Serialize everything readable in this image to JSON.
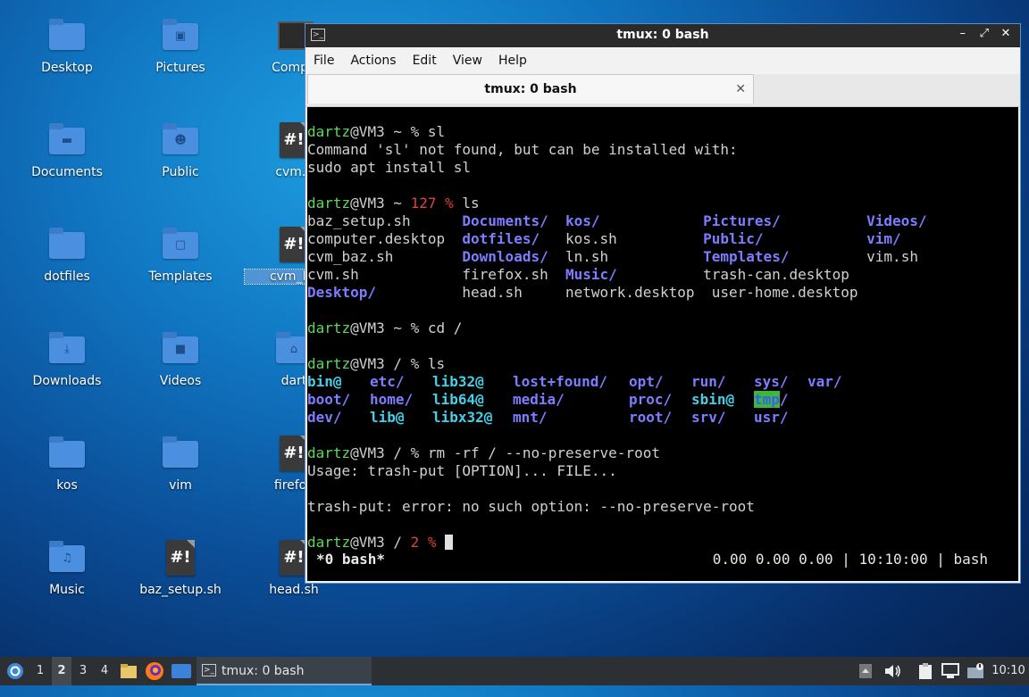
{
  "desktop": {
    "icons": [
      {
        "label": "Desktop",
        "type": "folder",
        "emblem": ""
      },
      {
        "label": "Pictures",
        "type": "folder",
        "emblem": "▣"
      },
      {
        "label": "Compu",
        "type": "monitor",
        "emblem": ""
      },
      {
        "label": "Documents",
        "type": "folder",
        "emblem": "▬"
      },
      {
        "label": "Public",
        "type": "folder",
        "emblem": "☻"
      },
      {
        "label": "cvm.s",
        "type": "script",
        "emblem": "#!"
      },
      {
        "label": "dotfiles",
        "type": "folder",
        "emblem": ""
      },
      {
        "label": "Templates",
        "type": "folder",
        "emblem": "▢"
      },
      {
        "label": "cvm_ba",
        "type": "script",
        "emblem": "#!"
      },
      {
        "label": "Downloads",
        "type": "folder",
        "emblem": "⤓"
      },
      {
        "label": "Videos",
        "type": "folder",
        "emblem": "■"
      },
      {
        "label": "dart",
        "type": "folder",
        "emblem": "⌂"
      },
      {
        "label": "kos",
        "type": "folder",
        "emblem": ""
      },
      {
        "label": "vim",
        "type": "folder",
        "emblem": ""
      },
      {
        "label": "firefox",
        "type": "script",
        "emblem": "#!"
      },
      {
        "label": "Music",
        "type": "folder",
        "emblem": "♫"
      },
      {
        "label": "baz_setup.sh",
        "type": "script",
        "emblem": "#!"
      },
      {
        "label": "head.sh",
        "type": "script",
        "emblem": "#!"
      }
    ]
  },
  "window": {
    "title": "tmux: 0 bash",
    "controls": {
      "minimize": "–",
      "maximize": "⤢",
      "close": "✕"
    },
    "menu": [
      "File",
      "Actions",
      "Edit",
      "View",
      "Help"
    ],
    "tab": {
      "label": "tmux: 0 bash",
      "close": "✕"
    }
  },
  "terminal": {
    "user": "dartz",
    "host": "@VM3",
    "l1": {
      "dir": " ~ ",
      "code": "",
      "sym": "% ",
      "cmd": "sl"
    },
    "out1": "Command 'sl' not found, but can be installed with:",
    "out2": "sudo apt install sl",
    "l2": {
      "dir": " ~ ",
      "code": "127 ",
      "sym": "% ",
      "cmd": "ls"
    },
    "home_ls": [
      [
        "baz_setup.sh      ",
        "Documents/",
        "  ",
        "kos/",
        "            ",
        "Pictures/",
        "          ",
        "Videos/"
      ],
      [
        "computer.desktop  ",
        "dotfiles/",
        "   ",
        "kos.sh",
        "          ",
        "Public/",
        "            ",
        "vim/"
      ],
      [
        "cvm_baz.sh        ",
        "Downloads/",
        "  ",
        "ln.sh",
        "           ",
        "Templates/",
        "         ",
        "vim.sh"
      ],
      [
        "cvm.sh            ",
        "firefox.sh",
        "  ",
        "Music/",
        "          ",
        "trash-can.desktop",
        "",
        ""
      ],
      [
        "Desktop/",
        "          ",
        "head.sh",
        "     ",
        "network.desktop",
        "  user-home.desktop",
        "",
        ""
      ]
    ],
    "l3": {
      "dir": " ~ ",
      "code": "",
      "sym": "% ",
      "cmd": "cd /"
    },
    "l4": {
      "dir": " / ",
      "code": "",
      "sym": "% ",
      "cmd": "ls"
    },
    "root_ls": [
      [
        "bin@",
        "etc/",
        "lib32@",
        "lost+found/",
        "opt/",
        "run/",
        "sys/",
        "var/"
      ],
      [
        "boot/",
        "home/",
        "lib64@",
        "media/",
        "proc/",
        "sbin@",
        "tmp",
        "/"
      ],
      [
        "dev/",
        "lib@",
        "libx32@",
        "mnt/",
        "root/",
        "srv/",
        "usr/",
        ""
      ]
    ],
    "l5": {
      "dir": " / ",
      "code": "",
      "sym": "% ",
      "cmd": "rm -rf / --no-preserve-root"
    },
    "out3": "Usage: trash-put [OPTION]... FILE...",
    "out4": "trash-put: error: no such option: --no-preserve-root",
    "l6": {
      "dir": " / ",
      "code": "2 ",
      "sym": "% ",
      "cmd": ""
    },
    "status_left": "*0 bash*",
    "status_right": "0.00 0.00 0.00 | 10:10:00 | bash"
  },
  "taskbar": {
    "workspaces": [
      "1",
      "2",
      "3",
      "4"
    ],
    "task_label": "tmux: 0 bash",
    "clock": "10:10"
  }
}
